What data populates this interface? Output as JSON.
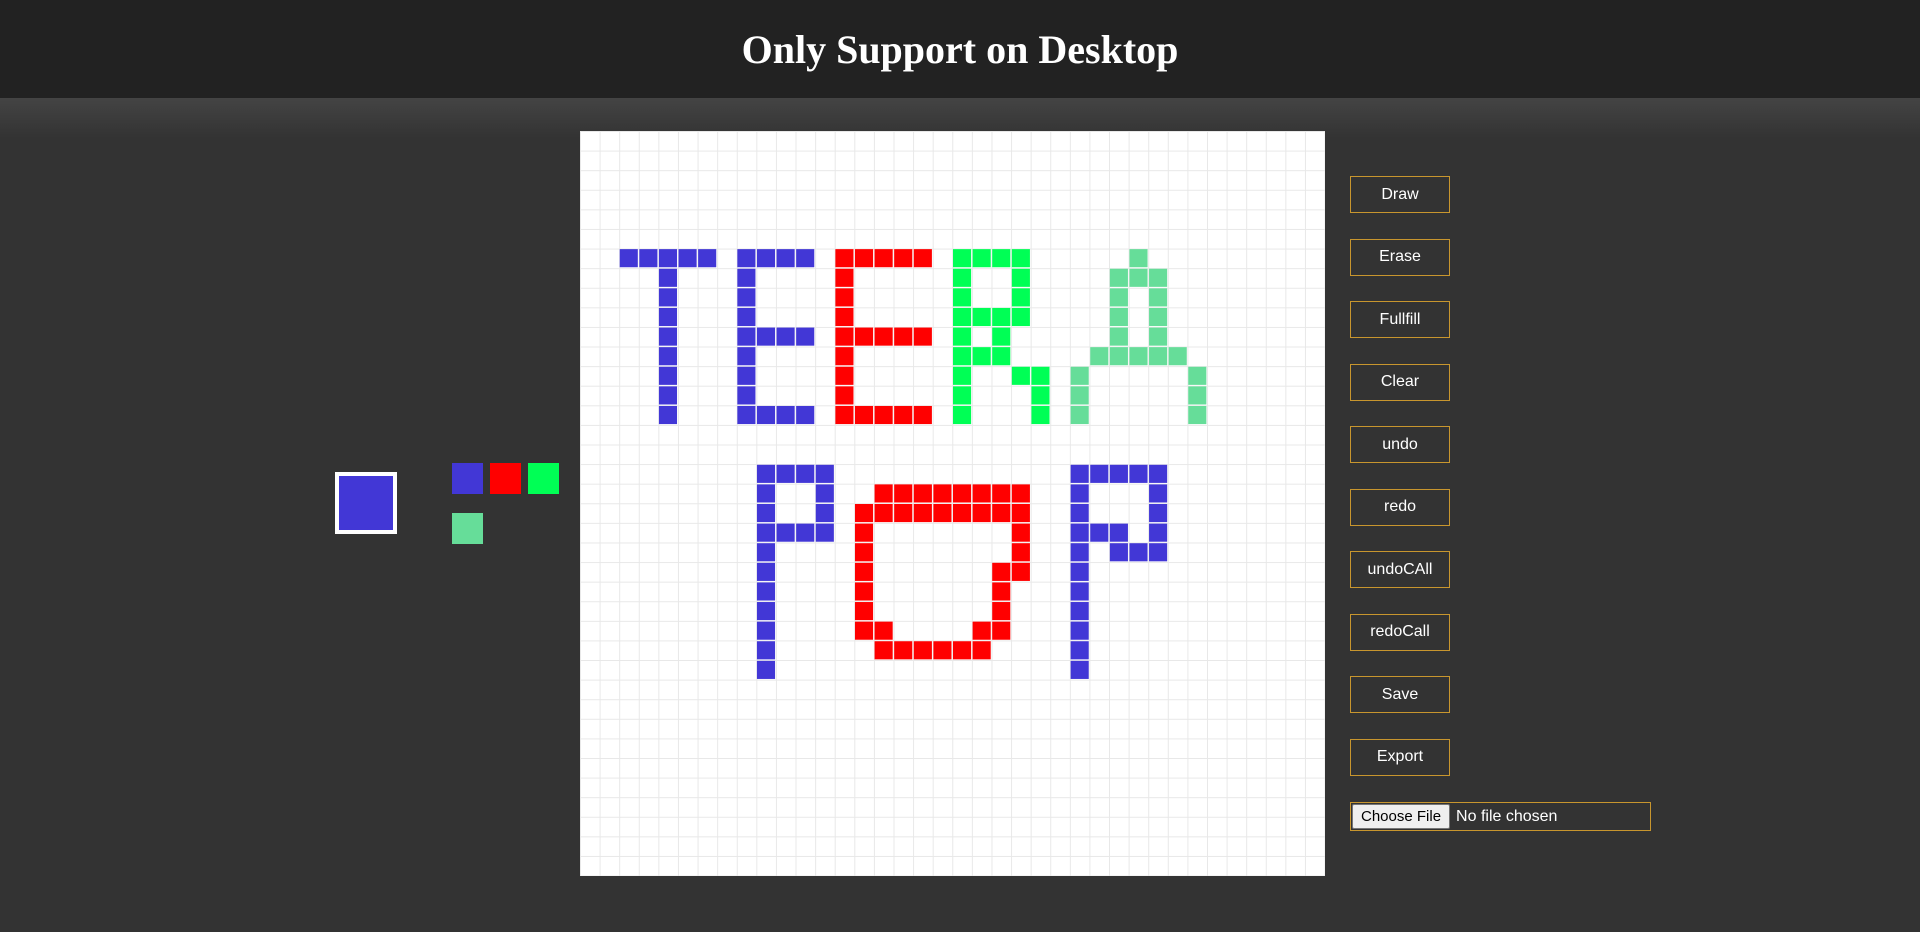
{
  "header": {
    "title": "Only Support on Desktop"
  },
  "colors": {
    "selected": "#4237d6",
    "palette": [
      "#4237d6",
      "#ff0000",
      "#00ff55",
      "#66dd99"
    ],
    "grid_background": "#ffffff",
    "grid_line": "#e8e8e8",
    "button_border": "#c8962e"
  },
  "tools": [
    {
      "label": "Draw"
    },
    {
      "label": "Erase"
    },
    {
      "label": "Fullfill"
    },
    {
      "label": "Clear"
    },
    {
      "label": "undo"
    },
    {
      "label": "redo"
    },
    {
      "label": "undoCAll"
    },
    {
      "label": "redoCall"
    },
    {
      "label": "Save"
    },
    {
      "label": "Export"
    }
  ],
  "file_input": {
    "button_label": "Choose File",
    "status": "No file chosen"
  },
  "pixel_grid": {
    "columns": 38,
    "rows": 38,
    "painted": [
      {
        "color": "#4237d6",
        "cells": [
          [
            2,
            6
          ],
          [
            3,
            6
          ],
          [
            4,
            6
          ],
          [
            5,
            6
          ],
          [
            6,
            6
          ],
          [
            4,
            7
          ],
          [
            4,
            8
          ],
          [
            4,
            9
          ],
          [
            4,
            10
          ],
          [
            4,
            11
          ],
          [
            4,
            12
          ],
          [
            4,
            13
          ],
          [
            4,
            14
          ],
          [
            8,
            6
          ],
          [
            9,
            6
          ],
          [
            10,
            6
          ],
          [
            11,
            6
          ],
          [
            8,
            7
          ],
          [
            8,
            8
          ],
          [
            8,
            9
          ],
          [
            8,
            10
          ],
          [
            8,
            11
          ],
          [
            8,
            12
          ],
          [
            8,
            13
          ],
          [
            8,
            14
          ],
          [
            9,
            10
          ],
          [
            10,
            10
          ],
          [
            11,
            10
          ],
          [
            9,
            14
          ],
          [
            10,
            14
          ],
          [
            11,
            14
          ],
          [
            9,
            17
          ],
          [
            10,
            17
          ],
          [
            11,
            17
          ],
          [
            12,
            17
          ],
          [
            9,
            18
          ],
          [
            9,
            19
          ],
          [
            9,
            20
          ],
          [
            9,
            21
          ],
          [
            9,
            22
          ],
          [
            9,
            23
          ],
          [
            9,
            24
          ],
          [
            9,
            25
          ],
          [
            9,
            26
          ],
          [
            9,
            27
          ],
          [
            12,
            18
          ],
          [
            12,
            19
          ],
          [
            10,
            20
          ],
          [
            11,
            20
          ],
          [
            12,
            20
          ],
          [
            25,
            17
          ],
          [
            26,
            17
          ],
          [
            27,
            17
          ],
          [
            28,
            17
          ],
          [
            29,
            17
          ],
          [
            25,
            18
          ],
          [
            25,
            19
          ],
          [
            25,
            20
          ],
          [
            25,
            21
          ],
          [
            25,
            22
          ],
          [
            25,
            23
          ],
          [
            25,
            24
          ],
          [
            25,
            25
          ],
          [
            25,
            26
          ],
          [
            25,
            27
          ],
          [
            29,
            18
          ],
          [
            29,
            19
          ],
          [
            29,
            20
          ],
          [
            29,
            21
          ],
          [
            26,
            20
          ],
          [
            27,
            20
          ],
          [
            27,
            21
          ],
          [
            28,
            21
          ]
        ]
      },
      {
        "color": "#ff0000",
        "cells": [
          [
            13,
            6
          ],
          [
            14,
            6
          ],
          [
            15,
            6
          ],
          [
            16,
            6
          ],
          [
            17,
            6
          ],
          [
            13,
            7
          ],
          [
            13,
            8
          ],
          [
            13,
            9
          ],
          [
            13,
            10
          ],
          [
            13,
            11
          ],
          [
            13,
            12
          ],
          [
            13,
            13
          ],
          [
            13,
            14
          ],
          [
            14,
            10
          ],
          [
            15,
            10
          ],
          [
            16,
            10
          ],
          [
            17,
            10
          ],
          [
            14,
            14
          ],
          [
            15,
            14
          ],
          [
            16,
            14
          ],
          [
            17,
            14
          ],
          [
            15,
            18
          ],
          [
            16,
            18
          ],
          [
            17,
            18
          ],
          [
            18,
            18
          ],
          [
            19,
            18
          ],
          [
            20,
            18
          ],
          [
            21,
            18
          ],
          [
            22,
            18
          ],
          [
            14,
            19
          ],
          [
            15,
            19
          ],
          [
            16,
            19
          ],
          [
            17,
            19
          ],
          [
            18,
            19
          ],
          [
            19,
            19
          ],
          [
            20,
            19
          ],
          [
            21,
            19
          ],
          [
            22,
            19
          ],
          [
            14,
            20
          ],
          [
            14,
            21
          ],
          [
            14,
            22
          ],
          [
            14,
            23
          ],
          [
            14,
            24
          ],
          [
            14,
            25
          ],
          [
            15,
            25
          ],
          [
            15,
            26
          ],
          [
            16,
            26
          ],
          [
            17,
            26
          ],
          [
            18,
            26
          ],
          [
            19,
            26
          ],
          [
            20,
            26
          ],
          [
            20,
            25
          ],
          [
            21,
            25
          ],
          [
            21,
            24
          ],
          [
            21,
            23
          ],
          [
            21,
            22
          ],
          [
            22,
            22
          ],
          [
            22,
            21
          ],
          [
            22,
            20
          ]
        ]
      },
      {
        "color": "#00ff55",
        "cells": [
          [
            19,
            6
          ],
          [
            20,
            6
          ],
          [
            21,
            6
          ],
          [
            22,
            6
          ],
          [
            19,
            7
          ],
          [
            19,
            8
          ],
          [
            19,
            9
          ],
          [
            19,
            10
          ],
          [
            19,
            11
          ],
          [
            19,
            12
          ],
          [
            19,
            13
          ],
          [
            19,
            14
          ],
          [
            22,
            7
          ],
          [
            22,
            8
          ],
          [
            20,
            9
          ],
          [
            21,
            9
          ],
          [
            22,
            9
          ],
          [
            21,
            10
          ],
          [
            20,
            11
          ],
          [
            21,
            11
          ],
          [
            22,
            12
          ],
          [
            23,
            12
          ],
          [
            23,
            13
          ],
          [
            23,
            14
          ]
        ]
      },
      {
        "color": "#66dd99",
        "cells": [
          [
            28,
            6
          ],
          [
            27,
            7
          ],
          [
            28,
            7
          ],
          [
            29,
            7
          ],
          [
            27,
            8
          ],
          [
            29,
            8
          ],
          [
            27,
            9
          ],
          [
            29,
            9
          ],
          [
            27,
            10
          ],
          [
            29,
            10
          ],
          [
            26,
            11
          ],
          [
            27,
            11
          ],
          [
            28,
            11
          ],
          [
            29,
            11
          ],
          [
            30,
            11
          ],
          [
            25,
            12
          ],
          [
            31,
            12
          ],
          [
            25,
            13
          ],
          [
            31,
            13
          ],
          [
            25,
            14
          ],
          [
            31,
            14
          ]
        ]
      }
    ]
  }
}
